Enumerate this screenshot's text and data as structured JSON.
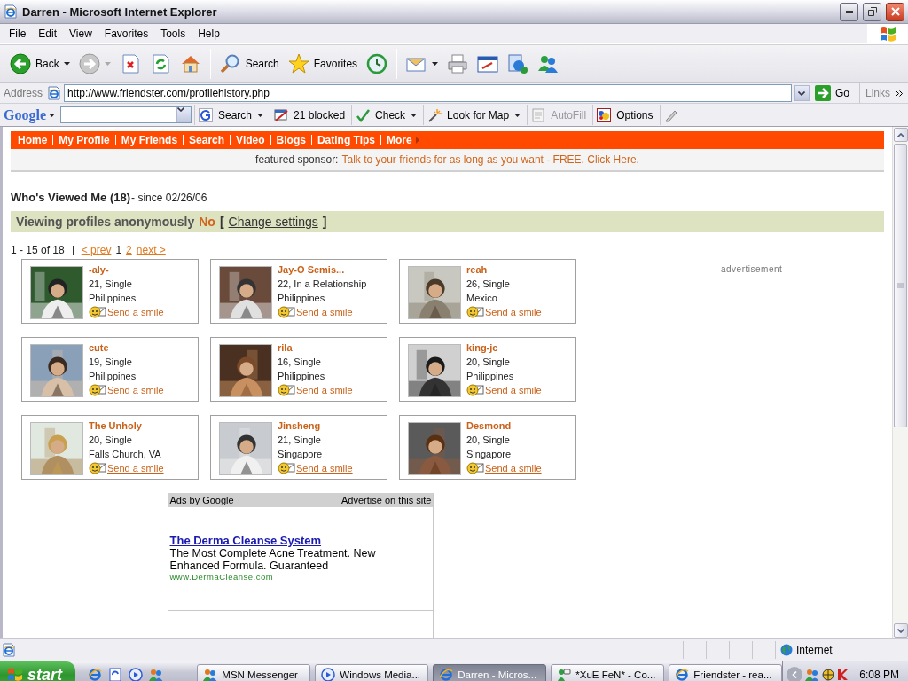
{
  "window": {
    "title": "Darren - Microsoft Internet Explorer"
  },
  "menu": [
    "File",
    "Edit",
    "View",
    "Favorites",
    "Tools",
    "Help"
  ],
  "toolbar": [
    {
      "kind": "back",
      "label": "Back"
    },
    {
      "kind": "forward"
    },
    {
      "kind": "stop"
    },
    {
      "kind": "refresh"
    },
    {
      "kind": "home"
    },
    {
      "kind": "search",
      "label": "Search"
    },
    {
      "kind": "favorites",
      "label": "Favorites"
    },
    {
      "kind": "history"
    },
    {
      "kind": "mail"
    },
    {
      "kind": "print"
    },
    {
      "kind": "edit"
    },
    {
      "kind": "research"
    },
    {
      "kind": "messenger"
    }
  ],
  "address": {
    "label": "Address",
    "url": "http://www.friendster.com/profilehistory.php",
    "go": "Go",
    "links": "Links"
  },
  "google_bar": {
    "logo": "Google",
    "items": [
      {
        "kind": "search",
        "label": "Search",
        "disabled": false
      },
      {
        "kind": "blocked",
        "label": "21 blocked",
        "disabled": false
      },
      {
        "kind": "check",
        "label": "Check",
        "disabled": false
      },
      {
        "kind": "map",
        "label": "Look for Map",
        "disabled": false
      },
      {
        "kind": "autofill",
        "label": "AutoFill",
        "disabled": true
      },
      {
        "kind": "options",
        "label": "Options",
        "disabled": false
      }
    ]
  },
  "site_nav": {
    "items": [
      "Home",
      "My Profile",
      "My Friends",
      "Search",
      "Video",
      "Blogs",
      "Dating Tips",
      "More"
    ]
  },
  "sponsor": {
    "label": "featured sponsor:",
    "link": "Talk to your friends for as long as you want - FREE. Click Here."
  },
  "heading": {
    "title": "Who's Viewed Me (18)",
    "since": "- since 02/26/06"
  },
  "privacy": {
    "label": "Viewing profiles anonymously",
    "value": "No",
    "open": "[",
    "link": "Change settings",
    "close": "]"
  },
  "pager": {
    "range": "1 - 15 of 18",
    "prev": "< prev",
    "pages": [
      {
        "label": "1",
        "selected": true
      },
      {
        "label": "2",
        "selected": false
      }
    ],
    "next": "next >"
  },
  "profiles": [
    {
      "name": "-aly-",
      "details": "21, Single",
      "location": "Philippines",
      "action": "Send a smile"
    },
    {
      "name": "Jay-O Semis...",
      "details": "22, In a Relationship",
      "location": "Philippines",
      "action": "Send a smile"
    },
    {
      "name": "reah",
      "details": "26, Single",
      "location": "Mexico",
      "action": "Send a smile"
    },
    {
      "name": "cute",
      "details": "19, Single",
      "location": "Philippines",
      "action": "Send a smile"
    },
    {
      "name": "rila",
      "details": "16, Single",
      "location": "Philippines",
      "action": "Send a smile"
    },
    {
      "name": "king-jc",
      "details": "20, Single",
      "location": "Philippines",
      "action": "Send a smile"
    },
    {
      "name": "The Unholy",
      "details": "20, Single",
      "location": "Falls Church, VA",
      "action": "Send a smile"
    },
    {
      "name": "Jinsheng",
      "details": "21, Single",
      "location": "Singapore",
      "action": "Send a smile"
    },
    {
      "name": "Desmond",
      "details": "20, Single",
      "location": "Singapore",
      "action": "Send a smile"
    }
  ],
  "advertisement_label": "advertisement",
  "ads": {
    "header_left": "Ads by Google",
    "header_right": "Advertise on this site",
    "items": [
      {
        "title": "The Derma Cleanse System",
        "text": "The Most Complete Acne Treatment. New Enhanced Formula. Guaranteed",
        "url": "www.DermaCleanse.com"
      }
    ]
  },
  "status_bar": {
    "zone": "Internet"
  },
  "taskbar": {
    "start": "start",
    "quick_launch": [
      {
        "kind": "ie"
      },
      {
        "kind": "outlook"
      },
      {
        "kind": "media"
      },
      {
        "kind": "messenger"
      }
    ],
    "tasks": [
      {
        "kind": "messenger",
        "label": "MSN Messenger",
        "selected": false
      },
      {
        "kind": "media",
        "label": "Windows Media...",
        "selected": false
      },
      {
        "kind": "ie",
        "label": "Darren - Micros...",
        "selected": true
      },
      {
        "kind": "chat",
        "label": "*XuE FeN* - Co...",
        "selected": false
      },
      {
        "kind": "ie",
        "label": "Friendster - rea...",
        "selected": false
      }
    ],
    "clock": "6:08 PM"
  }
}
